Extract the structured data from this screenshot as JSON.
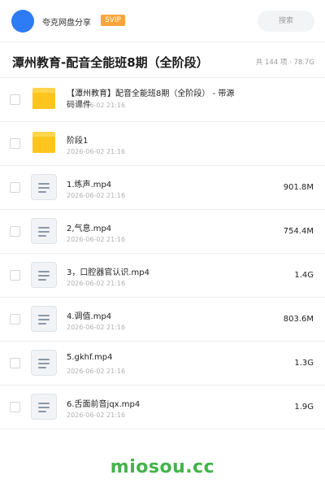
{
  "header": {
    "share_name": "夸克网盘分享",
    "badge": "SVIP",
    "search_label": "搜索",
    "avatar_color": "#2d7cf6",
    "badge_color": "#f7a63c"
  },
  "title": {
    "text": "潭州教育-配音全能班8期（全阶段）",
    "summary": "共 144 项 · 78.7G"
  },
  "files": [
    {
      "type": "folder",
      "icon": "folder-icon",
      "name": "【潭州教育】配音全能班8期（全阶段） - 带源码课件",
      "date": "2026-06-02 21:16",
      "size": ""
    },
    {
      "type": "folder",
      "icon": "folder-icon",
      "name": "阶段1",
      "date": "2026-06-02 21:16",
      "size": ""
    },
    {
      "type": "file",
      "icon": "document-icon",
      "name": "1.练声.mp4",
      "date": "2026-06-02 21:16",
      "size": "901.8M"
    },
    {
      "type": "file",
      "icon": "document-icon",
      "name": "2,气息.mp4",
      "date": "2026-06-02 21:16",
      "size": "754.4M"
    },
    {
      "type": "file",
      "icon": "document-icon",
      "name": "3，口腔器官认识.mp4",
      "date": "2026-06-02 21:16",
      "size": "1.4G"
    },
    {
      "type": "file",
      "icon": "document-icon",
      "name": "4.调值.mp4",
      "date": "2026-06-02 21:16",
      "size": "803.6M"
    },
    {
      "type": "file",
      "icon": "document-icon",
      "name": "5.gkhf.mp4",
      "date": "2026-06-02 21:16",
      "size": "1.3G"
    },
    {
      "type": "file",
      "icon": "document-icon",
      "name": "6.舌面前音jqx.mp4",
      "date": "2026-06-02 21:16",
      "size": "1.9G"
    }
  ],
  "watermark": "miosou.cc"
}
